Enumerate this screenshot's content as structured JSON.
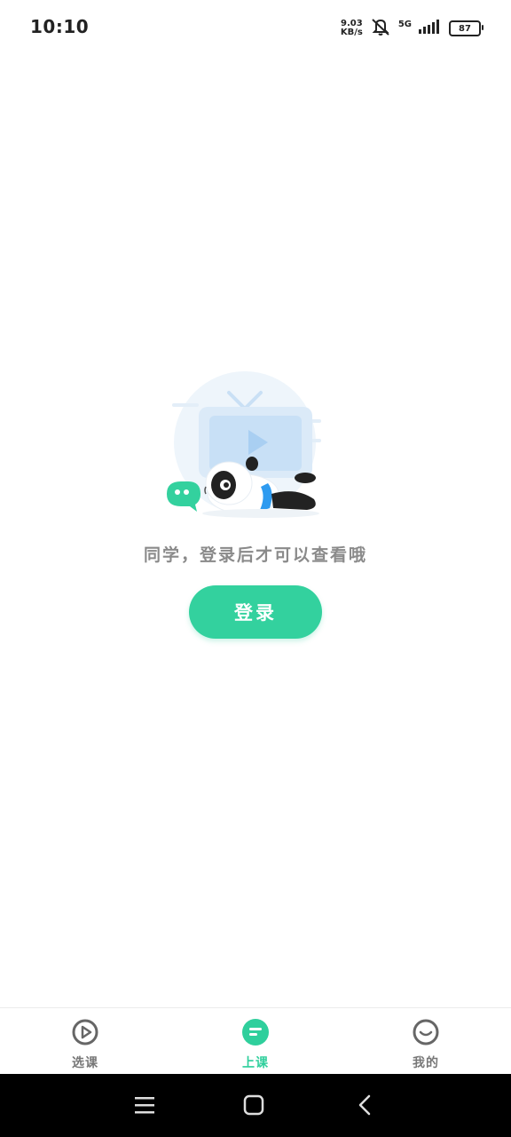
{
  "status_bar": {
    "time": "10:10",
    "net_speed_value": "9.03",
    "net_speed_unit": "KB/s",
    "network": "5G",
    "battery": "87",
    "icons": [
      "mute-icon",
      "signal-icon",
      "battery-icon"
    ]
  },
  "empty_state": {
    "message": "同学，登录后才可以查看哦",
    "login_label": "登录",
    "illustration": "panda-lying-tv-illustration"
  },
  "tab_bar": {
    "active_index": 1,
    "tabs": [
      {
        "label": "选课",
        "icon": "play-circle-icon"
      },
      {
        "label": "上课",
        "icon": "class-list-icon"
      },
      {
        "label": "我的",
        "icon": "smile-face-icon"
      }
    ]
  },
  "system_nav": {
    "buttons": [
      "menu-icon",
      "home-icon",
      "back-icon"
    ]
  },
  "colors": {
    "accent": "#33d19e",
    "tab_inactive": "#777777",
    "text_muted": "#8a8a8a",
    "nav_bg": "#000000"
  }
}
